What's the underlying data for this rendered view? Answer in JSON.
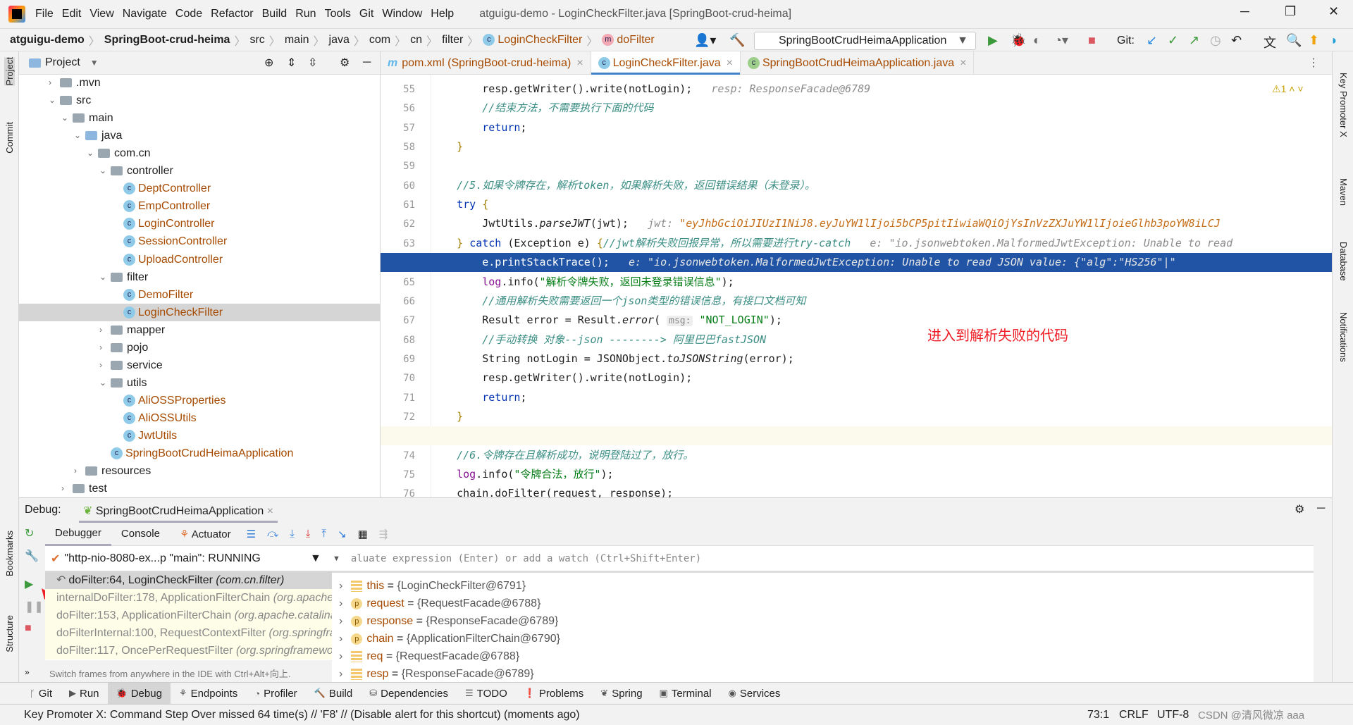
{
  "menubar": {
    "items": [
      "File",
      "Edit",
      "View",
      "Navigate",
      "Code",
      "Refactor",
      "Build",
      "Run",
      "Tools",
      "Git",
      "Window",
      "Help"
    ],
    "title": "atguigu-demo - LoginCheckFilter.java [SpringBoot-crud-heima]"
  },
  "breadcrumb": [
    "atguigu-demo",
    "SpringBoot-crud-heima",
    "src",
    "main",
    "java",
    "com",
    "cn",
    "filter",
    "LoginCheckFilter",
    "doFilter"
  ],
  "toolbar": {
    "run_config": "SpringBootCrudHeimaApplication",
    "git_label": "Git:"
  },
  "project": {
    "title": "Project",
    "tree": [
      {
        "label": ".mvn",
        "depth": 1,
        "type": "folder",
        "arrow": "›"
      },
      {
        "label": "src",
        "depth": 1,
        "type": "folder",
        "arrow": "⌄"
      },
      {
        "label": "main",
        "depth": 2,
        "type": "folder",
        "arrow": "⌄"
      },
      {
        "label": "java",
        "depth": 3,
        "type": "folder-blue",
        "arrow": "⌄"
      },
      {
        "label": "com.cn",
        "depth": 4,
        "type": "folder",
        "arrow": "⌄"
      },
      {
        "label": "controller",
        "depth": 5,
        "type": "folder",
        "arrow": "⌄"
      },
      {
        "label": "DeptController",
        "depth": 6,
        "type": "class"
      },
      {
        "label": "EmpController",
        "depth": 6,
        "type": "class"
      },
      {
        "label": "LoginController",
        "depth": 6,
        "type": "class"
      },
      {
        "label": "SessionController",
        "depth": 6,
        "type": "class"
      },
      {
        "label": "UploadController",
        "depth": 6,
        "type": "class"
      },
      {
        "label": "filter",
        "depth": 5,
        "type": "folder",
        "arrow": "⌄"
      },
      {
        "label": "DemoFilter",
        "depth": 6,
        "type": "class"
      },
      {
        "label": "LoginCheckFilter",
        "depth": 6,
        "type": "class",
        "selected": true
      },
      {
        "label": "mapper",
        "depth": 5,
        "type": "folder",
        "arrow": "›"
      },
      {
        "label": "pojo",
        "depth": 5,
        "type": "folder",
        "arrow": "›"
      },
      {
        "label": "service",
        "depth": 5,
        "type": "folder",
        "arrow": "›"
      },
      {
        "label": "utils",
        "depth": 5,
        "type": "folder",
        "arrow": "⌄"
      },
      {
        "label": "AliOSSProperties",
        "depth": 6,
        "type": "class"
      },
      {
        "label": "AliOSSUtils",
        "depth": 6,
        "type": "class"
      },
      {
        "label": "JwtUtils",
        "depth": 6,
        "type": "class"
      },
      {
        "label": "SpringBootCrudHeimaApplication",
        "depth": 5,
        "type": "class"
      },
      {
        "label": "resources",
        "depth": 3,
        "type": "folder",
        "arrow": "›"
      },
      {
        "label": "test",
        "depth": 2,
        "type": "folder",
        "arrow": "›"
      }
    ]
  },
  "editor": {
    "tabs": [
      {
        "label": "pom.xml (SpringBoot-crud-heima)",
        "icon": "m"
      },
      {
        "label": "LoginCheckFilter.java",
        "icon": "c",
        "active": true
      },
      {
        "label": "SpringBootCrudHeimaApplication.java",
        "icon": "spring"
      }
    ],
    "warnings": "1",
    "lines": [
      {
        "n": "55",
        "html": "        resp.getWriter().write(notLogin);   <span class='hint'>resp: ResponseFacade@6789</span>"
      },
      {
        "n": "56",
        "html": "        <span class='cm'>//结束方法，不需要执行下面的代码</span>"
      },
      {
        "n": "57",
        "html": "        <span class='kw'>return</span>;"
      },
      {
        "n": "58",
        "html": "    <span class='brace'>}</span>"
      },
      {
        "n": "59",
        "html": ""
      },
      {
        "n": "60",
        "html": "    <span class='cm'>//5.如果令牌存在，解析token，如果解析失败，返回错误结果（未登录）。</span>"
      },
      {
        "n": "61",
        "html": "    <span class='kw'>try</span> <span class='brace'>{</span>"
      },
      {
        "n": "62",
        "html": "        JwtUtils.<span class='it'>parseJWT</span>(jwt);   <span class='hint'>jwt: </span><span class='hv'>\"eyJhbGciOiJIUzI1NiJ8.eyJuYW1lIjoi5bCP5pitIiwiaWQiOjYsInVzZXJuYW1lIjoieGlhb3poYW8iLCJ</span>"
      },
      {
        "n": "63",
        "html": "    <span class='brace'>}</span> <span class='kw'>catch</span> (Exception e) <span class='brace'>{</span><span class='cm'>//jwt解析失败回报异常，所以需要进行try-catch</span>   <span class='hint'>e: \"io.jsonwebtoken.MalformedJwtException: Unable to read</span>"
      },
      {
        "n": "64",
        "html": "        e.printStackTrace();   <span class='hint'>e: \"io.jsonwebtoken.MalformedJwtException: Unable to read JSON value: {\"alg\":\"HS256\"|\"</span>",
        "hl": true
      },
      {
        "n": "65",
        "html": "        <span class='lg'>log</span>.info(<span class='str'>\"解析令牌失败，返回未登录错误信息\"</span>);"
      },
      {
        "n": "66",
        "html": "        <span class='cm'>//通用解析失败需要返回一个json类型的错误信息，有接口文档可知</span>"
      },
      {
        "n": "67",
        "html": "        Result error = Result.<span class='it'>error</span>( <span class='param'>msg:</span> <span class='str'>\"NOT_LOGIN\"</span>);"
      },
      {
        "n": "68",
        "html": "        <span class='cm'>//手动转换 对象--json --------&gt; 阿里巴巴fastJSON</span>"
      },
      {
        "n": "69",
        "html": "        String notLogin = JSONObject.<span class='it'>toJSONString</span>(error);"
      },
      {
        "n": "70",
        "html": "        resp.getWriter().write(notLogin);"
      },
      {
        "n": "71",
        "html": "        <span class='kw'>return</span>;"
      },
      {
        "n": "72",
        "html": "    <span class='brace'>}</span>"
      },
      {
        "n": "73",
        "html": "",
        "cur": true
      },
      {
        "n": "74",
        "html": "    <span class='cm'>//6.令牌存在且解析成功，说明登陆过了，放行。</span>"
      },
      {
        "n": "75",
        "html": "    <span class='lg'>log</span>.info(<span class='str'>\"令牌合法，放行\"</span>);"
      },
      {
        "n": "76",
        "html": "    chain.doFilter(request, response);"
      }
    ],
    "annotation": "进入到解析失败的代码"
  },
  "debug": {
    "label": "Debug:",
    "session": "SpringBootCrudHeimaApplication",
    "tabs": [
      "Debugger",
      "Console",
      "Actuator"
    ],
    "thread": "\"http-nio-8080-ex...p \"main\": RUNNING",
    "eval_placeholder": "Evaluate expression (Enter) or add a watch (Ctrl+Shift+Enter)",
    "frames": [
      {
        "name": "doFilter:64, LoginCheckFilter ",
        "pkg": "(com.cn.filter)"
      },
      {
        "name": "internalDoFilter:178, ApplicationFilterChain ",
        "pkg": "(org.apache.catalina.core)"
      },
      {
        "name": "doFilter:153, ApplicationFilterChain ",
        "pkg": "(org.apache.catalina.core)"
      },
      {
        "name": "doFilterInternal:100, RequestContextFilter ",
        "pkg": "(org.springframework)"
      },
      {
        "name": "doFilter:117, OncePerRequestFilter ",
        "pkg": "(org.springframework)"
      }
    ],
    "frames_hint": "Switch frames from anywhere in the IDE with Ctrl+Alt+向上.",
    "variables": [
      {
        "icon": "field",
        "name": "this",
        "value": "{LoginCheckFilter@6791}"
      },
      {
        "icon": "p",
        "name": "request",
        "value": "{RequestFacade@6788}"
      },
      {
        "icon": "p",
        "name": "response",
        "value": "{ResponseFacade@6789}"
      },
      {
        "icon": "p",
        "name": "chain",
        "value": "{ApplicationFilterChain@6790}"
      },
      {
        "icon": "field",
        "name": "req",
        "value": "{RequestFacade@6788}"
      },
      {
        "icon": "field",
        "name": "resp",
        "value": "{ResponseFacade@6789}"
      }
    ]
  },
  "sidebar_left": [
    "Project",
    "Commit",
    "Bookmarks",
    "Structure"
  ],
  "sidebar_right": [
    "Key Promoter X",
    "Maven",
    "Database",
    "Notifications"
  ],
  "bottom_tools": [
    "Git",
    "Run",
    "Debug",
    "Endpoints",
    "Profiler",
    "Build",
    "Dependencies",
    "TODO",
    "Problems",
    "Spring",
    "Terminal",
    "Services"
  ],
  "status": {
    "message": "Key Promoter X: Command Step Over missed 64 time(s) // 'F8' // (Disable alert for this shortcut) (moments ago)",
    "position": "73:1",
    "line_sep": "CRLF",
    "encoding": "UTF-8",
    "watermark": "CSDN @清风微凉 aaa"
  }
}
